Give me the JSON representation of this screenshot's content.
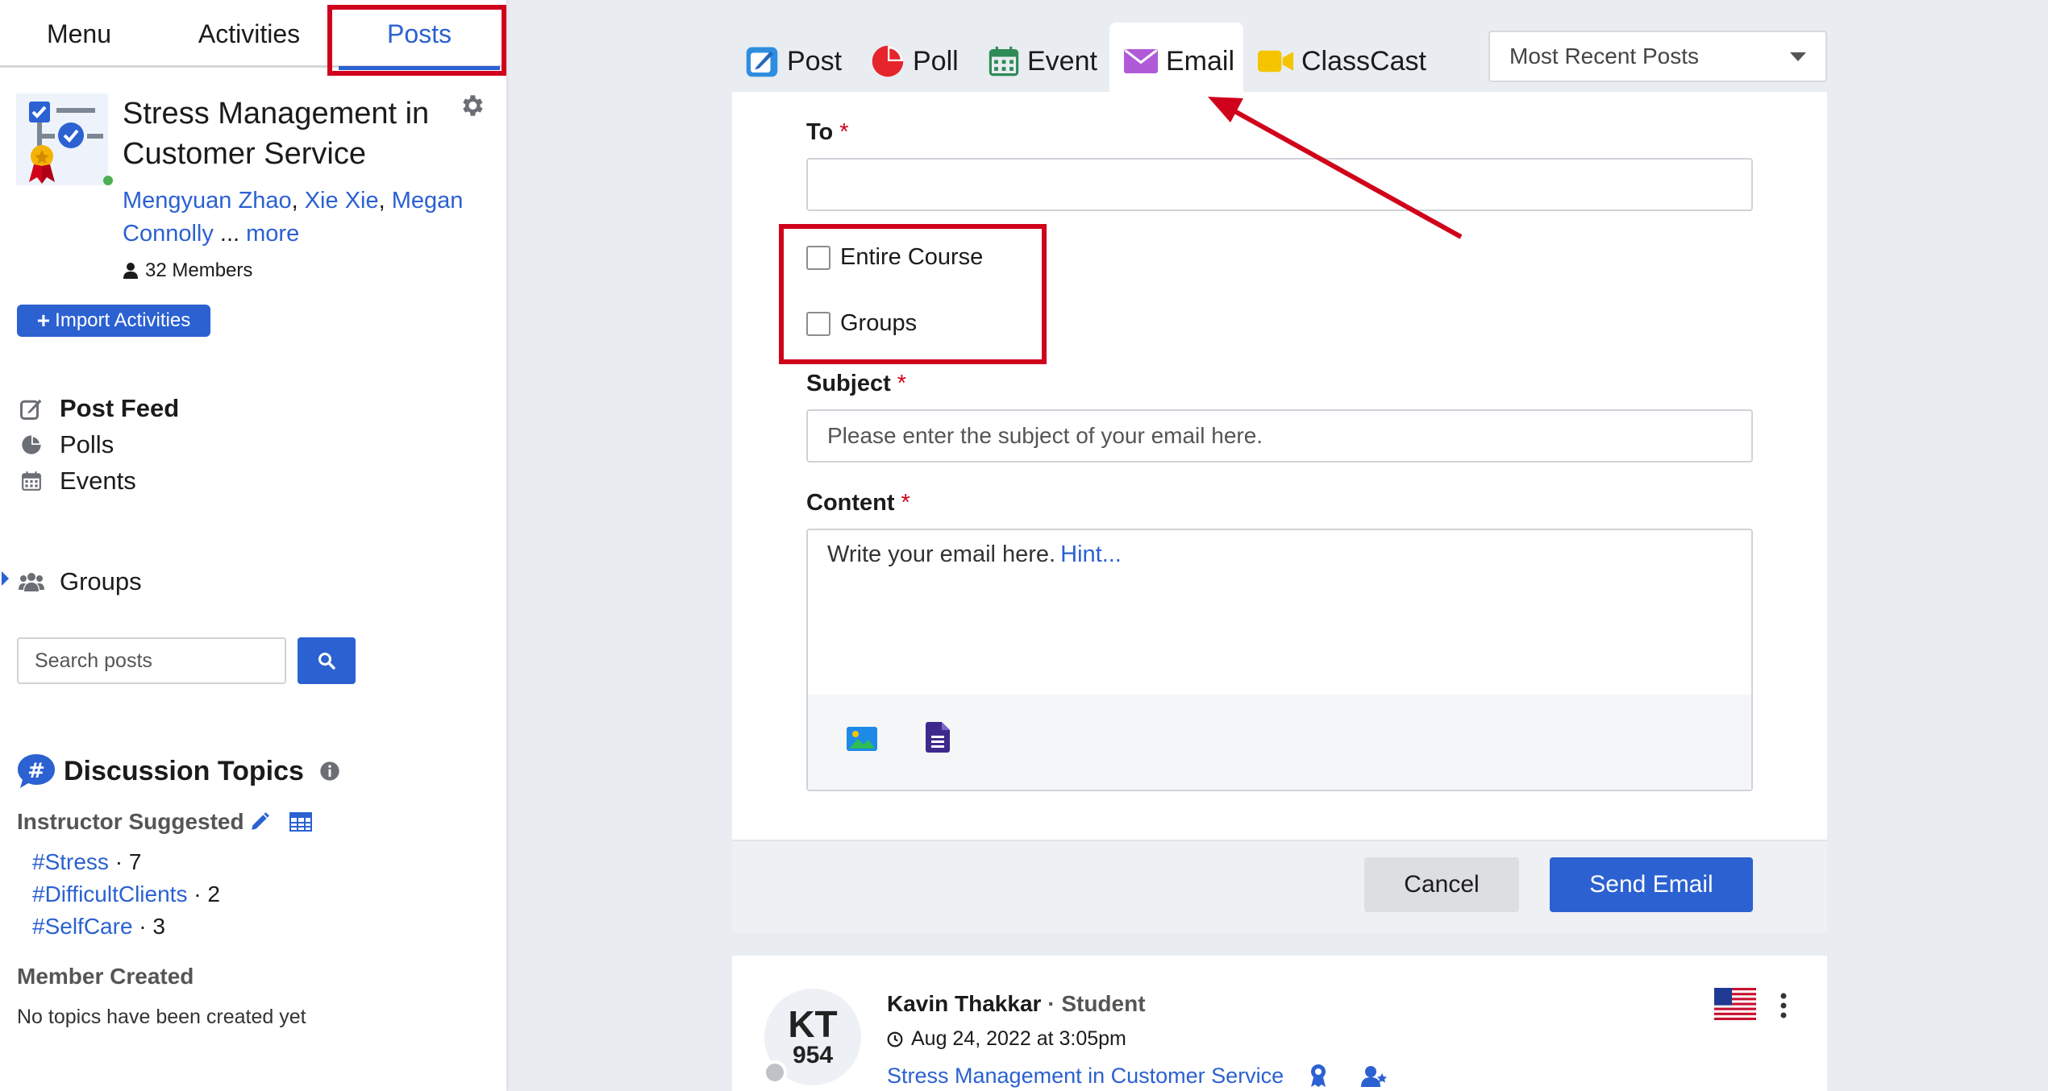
{
  "nav": {
    "menu": "Menu",
    "activities": "Activities",
    "posts": "Posts"
  },
  "course": {
    "title": "Stress Management in Customer Service",
    "instructors": [
      "Mengyuan Zhao",
      "Xie Xie",
      "Megan Connolly"
    ],
    "more": "more",
    "ellipsis": "...",
    "members": "32 Members",
    "import_label": "Import Activities"
  },
  "feed": {
    "post_feed": "Post Feed",
    "polls": "Polls",
    "events": "Events",
    "groups": "Groups"
  },
  "search": {
    "placeholder": "Search posts"
  },
  "discussion": {
    "title": "Discussion Topics",
    "instructor_suggested": "Instructor Suggested",
    "topics": [
      {
        "tag": "#Stress",
        "count": "7"
      },
      {
        "tag": "#DifficultClients",
        "count": "2"
      },
      {
        "tag": "#SelfCare",
        "count": "3"
      }
    ],
    "member_created": "Member Created",
    "no_topics": "No topics have been created yet"
  },
  "composer": {
    "tabs": {
      "post": "Post",
      "poll": "Poll",
      "event": "Event",
      "email": "Email",
      "classcast": "ClassCast"
    },
    "sort": "Most Recent Posts",
    "to_label": "To",
    "required_mark": "*",
    "entire_course": "Entire Course",
    "groups": "Groups",
    "subject_label": "Subject",
    "subject_placeholder": "Please enter the subject of your email here.",
    "content_label": "Content",
    "content_placeholder": "Write your email here.",
    "hint": "Hint...",
    "cancel": "Cancel",
    "send": "Send Email"
  },
  "post": {
    "initials": "KT",
    "number": "954",
    "author": "Kavin Thakkar",
    "separator": "·",
    "role": "Student",
    "date": "Aug 24, 2022 at 3:05pm",
    "course": "Stress Management in Customer Service"
  },
  "colors": {
    "accent": "#2b61d1",
    "highlight": "#d0021b",
    "online": "#4caf50"
  }
}
